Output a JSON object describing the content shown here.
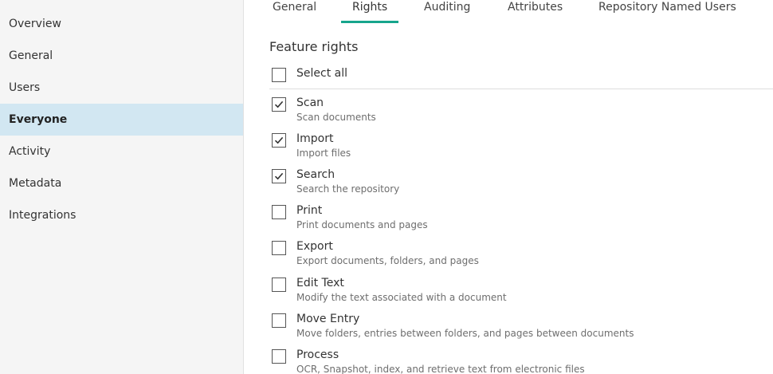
{
  "sidebar": {
    "items": [
      {
        "label": "Overview"
      },
      {
        "label": "General"
      },
      {
        "label": "Users"
      },
      {
        "label": "Everyone",
        "active": true
      },
      {
        "label": "Activity"
      },
      {
        "label": "Metadata"
      },
      {
        "label": "Integrations"
      }
    ]
  },
  "tabs": [
    {
      "label": "General"
    },
    {
      "label": "Rights",
      "active": true
    },
    {
      "label": "Auditing"
    },
    {
      "label": "Attributes"
    },
    {
      "label": "Repository Named Users"
    }
  ],
  "main": {
    "section_title": "Feature rights",
    "select_all": {
      "label": "Select all",
      "checked": false
    },
    "rights": [
      {
        "label": "Scan",
        "description": "Scan documents",
        "checked": true
      },
      {
        "label": "Import",
        "description": "Import files",
        "checked": true
      },
      {
        "label": "Search",
        "description": "Search the repository",
        "checked": true
      },
      {
        "label": "Print",
        "description": "Print documents and pages",
        "checked": false
      },
      {
        "label": "Export",
        "description": "Export documents, folders, and pages",
        "checked": false
      },
      {
        "label": "Edit Text",
        "description": "Modify the text associated with a document",
        "checked": false
      },
      {
        "label": "Move Entry",
        "description": "Move folders, entries between folders, and pages between documents",
        "checked": false
      },
      {
        "label": "Process",
        "description": "OCR, Snapshot, index, and retrieve text from electronic files",
        "checked": false
      }
    ]
  },
  "colors": {
    "accent": "#17a58c",
    "active_nav_bg": "#d2e7f2",
    "sidebar_bg": "#f5f5f5"
  },
  "icons": {
    "checkmark": "checkmark-icon"
  }
}
